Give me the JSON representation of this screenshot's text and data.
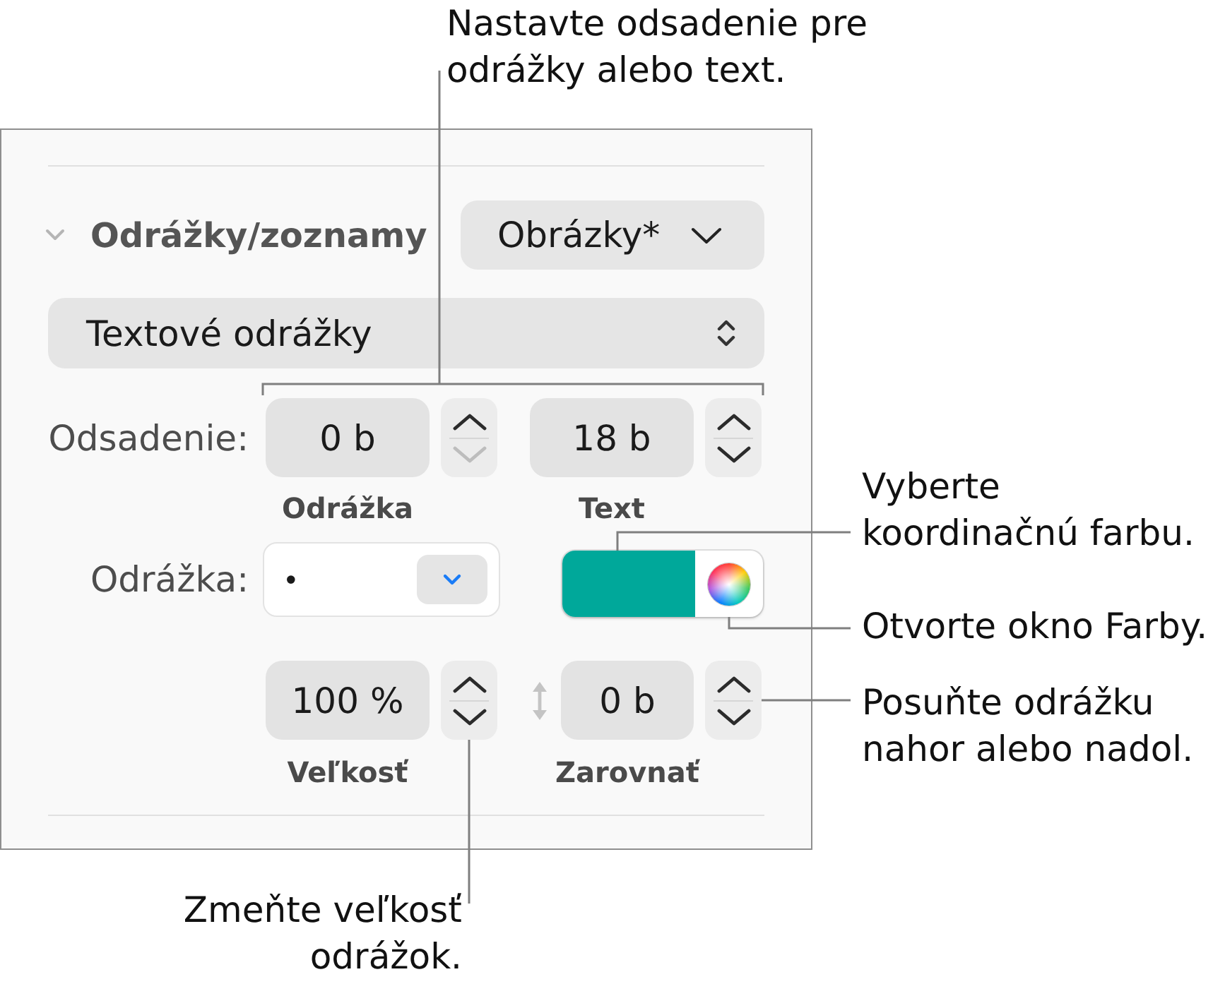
{
  "panel": {
    "section": {
      "title": "Odrážky/zoznamy",
      "expanded": true,
      "style_popup": "Obrázky*"
    },
    "bullet_type_popup": "Textové odrážky",
    "indent": {
      "label": "Odsadenie:",
      "fields": [
        {
          "value": "0 b",
          "caption": "Odrážka",
          "decrement_disabled": true
        },
        {
          "value": "18 b",
          "caption": "Text",
          "decrement_disabled": false
        }
      ]
    },
    "bullet": {
      "label": "Odrážka:",
      "character": "•",
      "color": "#00a89a"
    },
    "size": {
      "value": "100 %",
      "caption": "Veľkosť",
      "decrement_disabled": false
    },
    "align": {
      "value": "0 b",
      "caption": "Zarovnať",
      "decrement_disabled": false
    }
  },
  "callouts": {
    "indent": "Nastavte odsadenie pre\nodrážky alebo text.",
    "bullet_fill": "Vyberte\nkoordinačnú farbu.",
    "colors_window": "Otvorte okno Farby.",
    "align": "Posuňte odrážku\nnahor alebo nadol.",
    "size": "Zmeňte veľkosť\nodrážok."
  }
}
